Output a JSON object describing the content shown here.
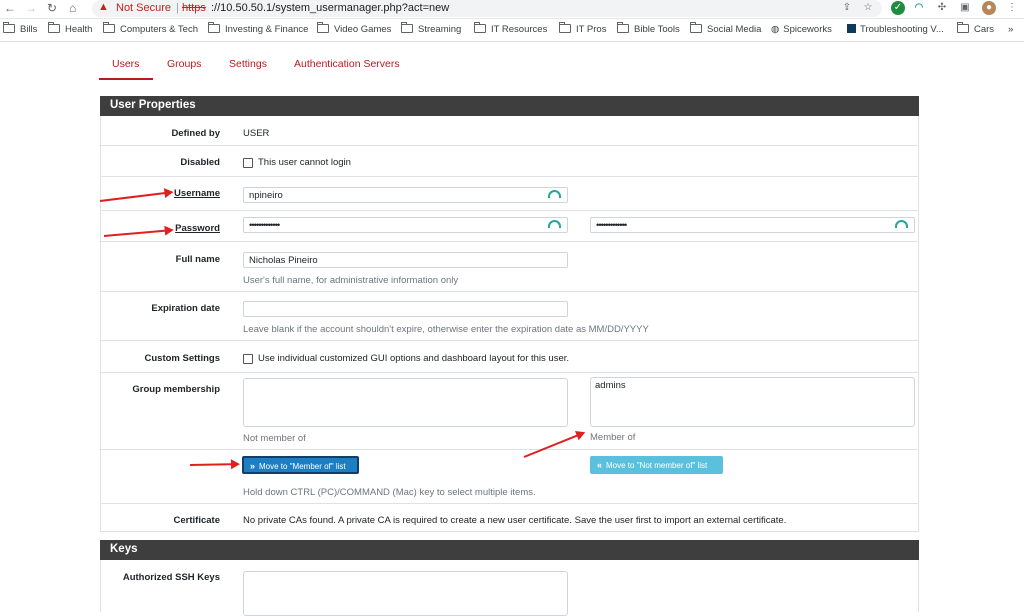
{
  "browser": {
    "security_label": "Not Secure",
    "url_protocol": "https",
    "url_rest": "://10.50.50.1/system_usermanager.php?act=new",
    "bookmarks": [
      "Bills",
      "Health",
      "Computers & Tech",
      "Investing & Finance",
      "Video Games",
      "Streaming",
      "IT Resources",
      "IT Pros",
      "Bible Tools",
      "Social Media",
      "Spiceworks",
      "Troubleshooting V...",
      "Cars"
    ],
    "more": "»"
  },
  "tabs": [
    "Users",
    "Groups",
    "Settings",
    "Authentication Servers"
  ],
  "user_properties": {
    "title": "User Properties",
    "defined_by_label": "Defined by",
    "defined_by_value": "USER",
    "disabled_label": "Disabled",
    "disabled_checkbox_text": "This user cannot login",
    "username_label": "Username",
    "username_value": "npineiro",
    "password_label": "Password",
    "password_value": "•••••••••••••",
    "password_confirm_value": "•••••••••••••",
    "fullname_label": "Full name",
    "fullname_value": "Nicholas Pineiro",
    "fullname_help": "User's full name, for administrative information only",
    "expiration_label": "Expiration date",
    "expiration_value": "",
    "expiration_help": "Leave blank if the account shouldn't expire, otherwise enter the expiration date as MM/DD/YYYY",
    "custom_settings_label": "Custom Settings",
    "custom_settings_checkbox_text": "Use individual customized GUI options and dashboard layout for this user.",
    "group_membership_label": "Group membership",
    "not_member_of_caption": "Not member of",
    "member_of_caption": "Member of",
    "member_of_items": [
      "admins"
    ],
    "move_to_member_button": "Move to \"Member of\" list",
    "move_to_not_member_button": "Move to \"Not member of\" list",
    "multi_select_help": "Hold down CTRL (PC)/COMMAND (Mac) key to select multiple items.",
    "certificate_label": "Certificate",
    "certificate_text": "No private CAs found. A private CA is required to create a new user certificate. Save the user first to import an external certificate."
  },
  "keys": {
    "title": "Keys",
    "ssh_label": "Authorized SSH Keys"
  },
  "colors": {
    "accent": "#b41c1c",
    "header_bg": "#3e3e3e",
    "primary_button": "#1d7fc3",
    "info_button": "#5bc0de",
    "annotation_arrow": "#e02020"
  }
}
